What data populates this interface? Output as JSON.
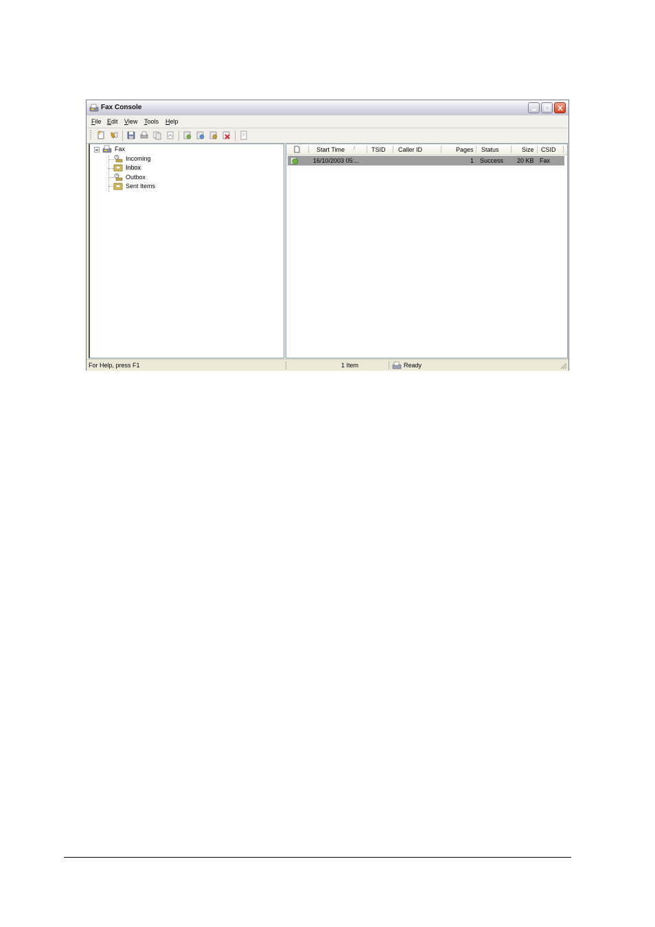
{
  "window": {
    "title": "Fax Console",
    "icon": "fax-icon",
    "controls": [
      "minimize",
      "maximize",
      "close"
    ]
  },
  "menubar": {
    "items": [
      {
        "accel": "F",
        "rest": "ile"
      },
      {
        "accel": "E",
        "rest": "dit"
      },
      {
        "accel": "V",
        "rest": "iew"
      },
      {
        "accel": "T",
        "rest": "ools"
      },
      {
        "accel": "H",
        "rest": "elp"
      }
    ]
  },
  "toolbar": {
    "icons": [
      "new-fax-icon",
      "receive-fax-icon",
      "save-icon",
      "print-icon",
      "copy-icon",
      "mail-icon",
      "view-icon",
      "pause-icon",
      "resume-icon",
      "delete-icon",
      "properties-icon"
    ]
  },
  "tree": {
    "root": {
      "label": "Fax",
      "icon": "fax-icon",
      "expanded": true
    },
    "children": [
      {
        "label": "Incoming",
        "icon": "incoming-icon"
      },
      {
        "label": "Inbox",
        "icon": "inbox-icon",
        "selected": true
      },
      {
        "label": "Outbox",
        "icon": "outbox-icon"
      },
      {
        "label": "Sent Items",
        "icon": "sent-items-icon"
      }
    ]
  },
  "list": {
    "columns": [
      "Start Time",
      "TSID",
      "Caller ID",
      "Pages",
      "Status",
      "Size",
      "CSID"
    ],
    "sort_indicator": "/",
    "rows": [
      {
        "start_time": "16/10/2003 05:...",
        "tsid": "",
        "caller_id": "",
        "pages": "1",
        "status": "Success",
        "size": "20 KB",
        "csid": "Fax"
      }
    ]
  },
  "statusbar": {
    "help": "For Help, press F1",
    "count": "1 Item",
    "state": "Ready"
  },
  "colors": {
    "selected_row": "#9d9d9d",
    "title_gradient_top": "#fbfbfd",
    "close_button": "#d7401f"
  }
}
